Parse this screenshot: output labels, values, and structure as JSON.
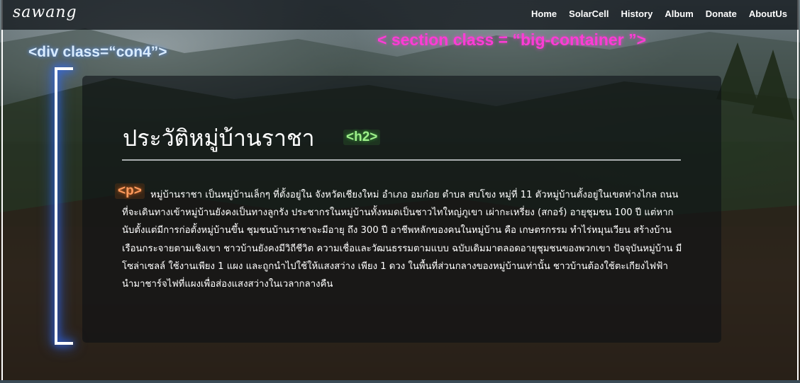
{
  "navbar": {
    "logo": "sawang",
    "links": [
      "Home",
      "SolarCell",
      "History",
      "Album",
      "Donate",
      "AboutUs"
    ]
  },
  "annotations": {
    "section": "< section class = “big-container ”>",
    "div": "<div class=“con4”>",
    "h2": "<h2>",
    "p": "<p>"
  },
  "content": {
    "title": "ประวัติหมู่บ้านราชา",
    "paragraph": "หมู่บ้านราชา เป็นหมู่บ้านเล็กๆ ที่ตั้งอยู่ใน จังหวัดเชียงใหม่ อำเภอ อมก๋อย ตำบล สบโขง หมู่ที่ 11 ตัวหมู่บ้านตั้งอยู่ในเขตห่างไกล ถนนที่จะเดินทางเข้าหมู่บ้านยังคงเป็นทางลูกรัง ประชากรในหมู่บ้านทั้งหมดเป็นชาวไทใหญ่ภูเขา เผ่ากะเหรี่ยง (สกอร์) อายุชุมชน 100 ปี แต่หากนับตั้งแต่มีการก่อตั้งหมู่บ้านขึ้น ชุมชนบ้านราชาจะมีอายุ ถึง 300 ปี อาชีพหลักของคนในหมู่บ้าน คือ เกษตรกรรม ทำไร่หมุนเวียน สร้างบ้านเรือนกระจายตามเชิงเขา ชาวบ้านยังคงมีวิถีชีวิต ความเชื่อและวัฒนธรรมตามแบบ ฉบับเดิมมาตลอดอายุชุมชนของพวกเขา ปัจจุบันหมู่บ้าน มีโซล่าเซลล์ ใช้งานเพียง 1 แผง และถูกนำไปใช้ให้แสงสว่าง เพียง 1 ดวง ในพื้นที่ส่วนกลางของหมู่บ้านเท่านั้น ชาวบ้านต้องใช้ตะเกียงไฟฟ้า นำมาชาร์จไฟที่แผงเพื่อส่องแสงสว่างในเวลากลางคืน"
  },
  "colors": {
    "section_annotation": "#ff3bd6",
    "div_annotation": "#d9ecff",
    "h2_annotation": "#9ef08a",
    "p_annotation": "#ff9a5c",
    "bracket_glow": "#2e6bff"
  }
}
